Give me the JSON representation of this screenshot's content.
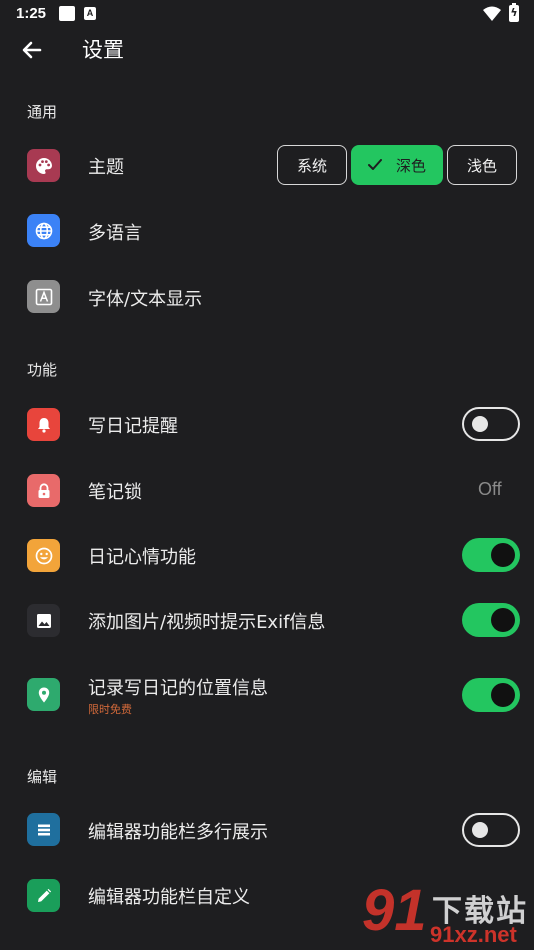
{
  "status_bar": {
    "time": "1:25",
    "notif_icon_letter": "A"
  },
  "header": {
    "title": "设置"
  },
  "sections": {
    "general": "通用",
    "features": "功能",
    "editor": "编辑"
  },
  "general": {
    "theme": {
      "label": "主题",
      "options": [
        "系统",
        "深色",
        "浅色"
      ],
      "selected": "深色"
    },
    "language": {
      "label": "多语言"
    },
    "font": {
      "label": "字体/文本显示"
    }
  },
  "features": {
    "reminder": {
      "label": "写日记提醒",
      "enabled": false
    },
    "lock": {
      "label": "笔记锁",
      "value": "Off"
    },
    "mood": {
      "label": "日记心情功能",
      "enabled": true
    },
    "exif": {
      "label": "添加图片/视频时提示Exif信息",
      "enabled": true
    },
    "location": {
      "label": "记录写日记的位置信息",
      "badge": "限时免费",
      "enabled": true
    }
  },
  "editor": {
    "multiline_toolbar": {
      "label": "编辑器功能栏多行展示",
      "enabled": false
    },
    "custom_toolbar": {
      "label": "编辑器功能栏自定义"
    }
  },
  "watermark": {
    "logo": "91",
    "text": "下载站",
    "url": "91xz.net"
  },
  "colors": {
    "background": "#1e1e20",
    "accent_green": "#23c660",
    "theme_icon": "#a83a52",
    "language_icon": "#3b82f6",
    "font_icon": "#8e8e8e",
    "reminder_icon": "#e8453c",
    "lock_icon": "#e86a6a",
    "mood_icon": "#f2a43a",
    "image_icon": "#2c2c30",
    "location_icon": "#2eaa6e",
    "multiline_icon": "#1f6f9e",
    "custom_icon": "#1a9e5a",
    "badge_orange": "#d2693a"
  }
}
